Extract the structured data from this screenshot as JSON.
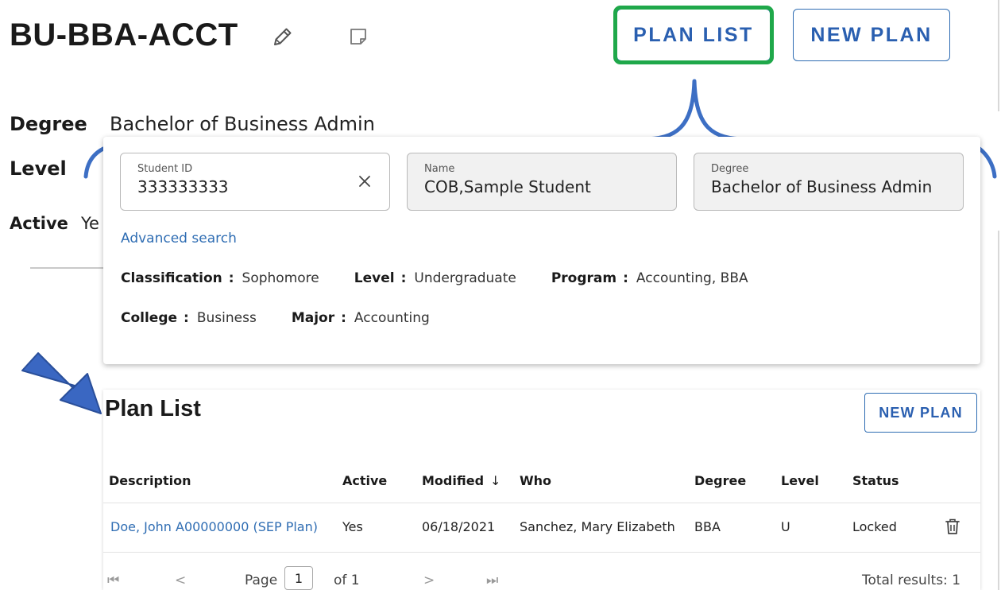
{
  "header": {
    "title": "BU-BBA-ACCT",
    "plan_list_label": "PLAN LIST",
    "new_plan_label": "NEW PLAN"
  },
  "details": {
    "degree_label": "Degree",
    "degree_value": "Bachelor of Business Admin",
    "level_label": "Level",
    "active_label": "Active",
    "active_value": "Ye"
  },
  "student_card": {
    "student_id": {
      "label": "Student ID",
      "value": "333333333"
    },
    "name": {
      "label": "Name",
      "value": "COB,Sample Student"
    },
    "degree": {
      "label": "Degree",
      "value": "Bachelor of Business Admin"
    },
    "advanced_search": "Advanced search",
    "info": {
      "classification_label": "Classification",
      "classification_value": "Sophomore",
      "level_label": "Level",
      "level_value": "Undergraduate",
      "program_label": "Program",
      "program_value": "Accounting, BBA",
      "college_label": "College",
      "college_value": "Business",
      "major_label": "Major",
      "major_value": "Accounting",
      "colon": ":"
    }
  },
  "plan_list": {
    "heading": "Plan List",
    "new_plan_label": "NEW PLAN",
    "columns": [
      "Description",
      "Active",
      "Modified",
      "Who",
      "Degree",
      "Level",
      "Status"
    ],
    "sort_indicator": "↓",
    "rows": [
      {
        "description": "Doe, John A00000000 (SEP Plan)",
        "active": "Yes",
        "modified": "06/18/2021",
        "who": "Sanchez, Mary Elizabeth",
        "degree": "BBA",
        "level": "U",
        "status": "Locked"
      }
    ],
    "pagination": {
      "page_label": "Page",
      "current_page": "1",
      "of_label": "of 1",
      "total_results": "Total results: 1"
    }
  },
  "annotation_colors": {
    "highlight": "#1fa84a",
    "brace": "#3d6fc4",
    "arrow": "#3a67c2"
  },
  "icons": [
    "pencil-icon",
    "note-icon",
    "clear-icon",
    "sort-down-icon",
    "trash-icon",
    "first-page-icon",
    "prev-page-icon",
    "next-page-icon",
    "last-page-icon"
  ]
}
